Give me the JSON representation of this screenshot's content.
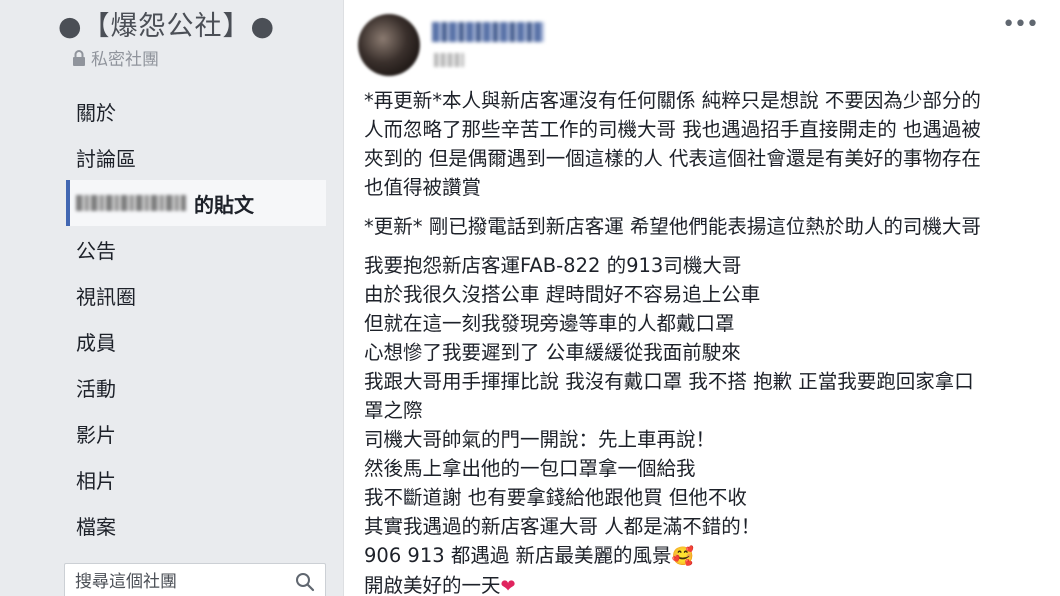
{
  "group": {
    "title": "●【爆怨公社】●",
    "privacy": "私密社團"
  },
  "sidebar": {
    "items": [
      {
        "label": "關於"
      },
      {
        "label": "討論區"
      },
      {
        "label": "的貼文"
      },
      {
        "label": "公告"
      },
      {
        "label": "視訊圈"
      },
      {
        "label": "成員"
      },
      {
        "label": "活動"
      },
      {
        "label": "影片"
      },
      {
        "label": "相片"
      },
      {
        "label": "檔案"
      }
    ]
  },
  "search": {
    "placeholder": "搜尋這個社團"
  },
  "post": {
    "update2": [
      "*再更新*本人與新店客運沒有任何關係 純粹只是想說 不要因為少部分的",
      "人而忽略了那些辛苦工作的司機大哥 我也遇過招手直接開走的 也遇過被",
      "夾到的 但是偶爾遇到一個這樣的人 代表這個社會還是有美好的事物存在",
      "也值得被讚賞"
    ],
    "update1": "*更新* 剛已撥電話到新店客運 希望他們能表揚這位熱於助人的司機大哥",
    "story": [
      "我要抱怨新店客運FAB-822 的913司機大哥",
      "由於我很久沒搭公車 趕時間好不容易追上公車",
      "但就在這一刻我發現旁邊等車的人都戴口罩",
      "心想慘了我要遲到了 公車緩緩從我面前駛來",
      "我跟大哥用手揮揮比說 我沒有戴口罩 我不搭 抱歉 正當我要跑回家拿口",
      "罩之際",
      "司機大哥帥氣的門一開說：先上車再說！",
      "然後馬上拿出他的一包口罩拿一個給我",
      "我不斷道謝 也有要拿錢給他跟他買 但他不收",
      "其實我遇過的新店客運大哥 人都是滿不錯的！",
      "906 913 都遇過 新店最美麗的風景",
      "開啟美好的一天"
    ],
    "emoji_smile": "🥰",
    "emoji_heart": "❤"
  },
  "colors": {
    "accent": "#4267b2",
    "page_bg": "#e9ebee"
  }
}
